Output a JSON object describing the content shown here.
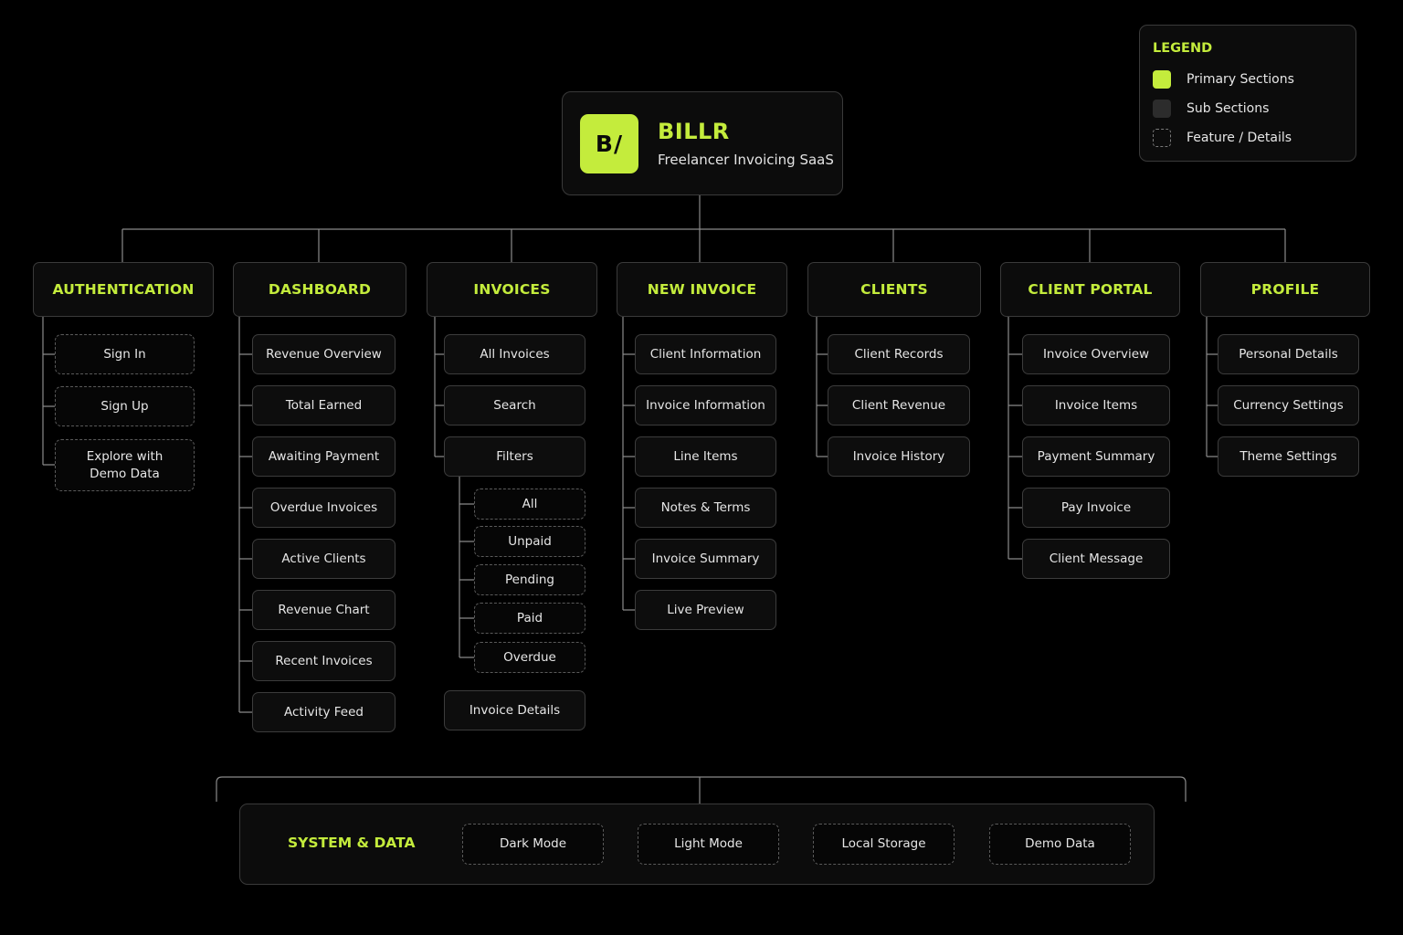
{
  "root": {
    "logo": "B/",
    "title": "BILLR",
    "subtitle": "Freelancer Invoicing SaaS"
  },
  "legend": {
    "title": "LEGEND",
    "items": [
      "Primary Sections",
      "Sub Sections",
      "Feature / Details"
    ]
  },
  "sections": [
    {
      "title": "AUTHENTICATION",
      "items": [
        "Sign In",
        "Sign Up",
        "Explore with\nDemo Data"
      ]
    },
    {
      "title": "DASHBOARD",
      "items": [
        "Revenue Overview",
        "Total Earned",
        "Awaiting Payment",
        "Overdue Invoices",
        "Active Clients",
        "Revenue Chart",
        "Recent Invoices",
        "Activity Feed"
      ]
    },
    {
      "title": "INVOICES",
      "items": [
        "All Invoices",
        "Search",
        "Filters",
        "Invoice Details"
      ],
      "filters": [
        "All",
        "Unpaid",
        "Pending",
        "Paid",
        "Overdue"
      ]
    },
    {
      "title": "NEW INVOICE",
      "items": [
        "Client Information",
        "Invoice Information",
        "Line Items",
        "Notes & Terms",
        "Invoice Summary",
        "Live Preview"
      ]
    },
    {
      "title": "CLIENTS",
      "items": [
        "Client Records",
        "Client Revenue",
        "Invoice History"
      ]
    },
    {
      "title": "CLIENT PORTAL",
      "items": [
        "Invoice Overview",
        "Invoice Items",
        "Payment Summary",
        "Pay Invoice",
        "Client Message"
      ]
    },
    {
      "title": "PROFILE",
      "items": [
        "Personal Details",
        "Currency Settings",
        "Theme Settings"
      ]
    }
  ],
  "system": {
    "title": "SYSTEM & DATA",
    "items": [
      "Dark Mode",
      "Light Mode",
      "Local Storage",
      "Demo Data"
    ]
  },
  "colors": {
    "accent": "#c4ec3c",
    "background": "#000000",
    "line": "#8a8a8a"
  }
}
